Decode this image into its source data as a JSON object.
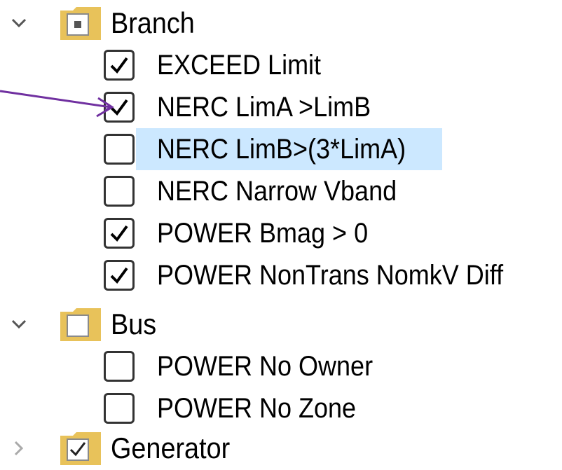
{
  "tree": {
    "groups": [
      {
        "label": "Branch",
        "expanded": true,
        "folder_state": "indeterminate",
        "items": [
          {
            "label": "EXCEED Limit",
            "checked": true,
            "selected": false
          },
          {
            "label": "NERC LimA >LimB",
            "checked": true,
            "selected": false
          },
          {
            "label": "NERC LimB>(3*LimA)",
            "checked": false,
            "selected": true
          },
          {
            "label": "NERC Narrow Vband",
            "checked": false,
            "selected": false
          },
          {
            "label": "POWER Bmag > 0",
            "checked": true,
            "selected": false
          },
          {
            "label": "POWER NonTrans NomkV Diff",
            "checked": true,
            "selected": false
          }
        ]
      },
      {
        "label": "Bus",
        "expanded": true,
        "folder_state": "unchecked",
        "items": [
          {
            "label": "POWER No Owner",
            "checked": false,
            "selected": false
          },
          {
            "label": "POWER No Zone",
            "checked": false,
            "selected": false
          }
        ]
      },
      {
        "label": "Generator",
        "expanded": false,
        "folder_state": "checked",
        "items": []
      }
    ]
  },
  "icons": {
    "expanded": "chevron-down-icon",
    "collapsed": "chevron-right-icon",
    "folder": "folder-icon",
    "checkbox": "checkbox-icon",
    "annotation": "arrow-annotation"
  },
  "colors": {
    "selection": "#cce8ff",
    "folder": "#e8c25a",
    "arrow": "#7030a0"
  }
}
